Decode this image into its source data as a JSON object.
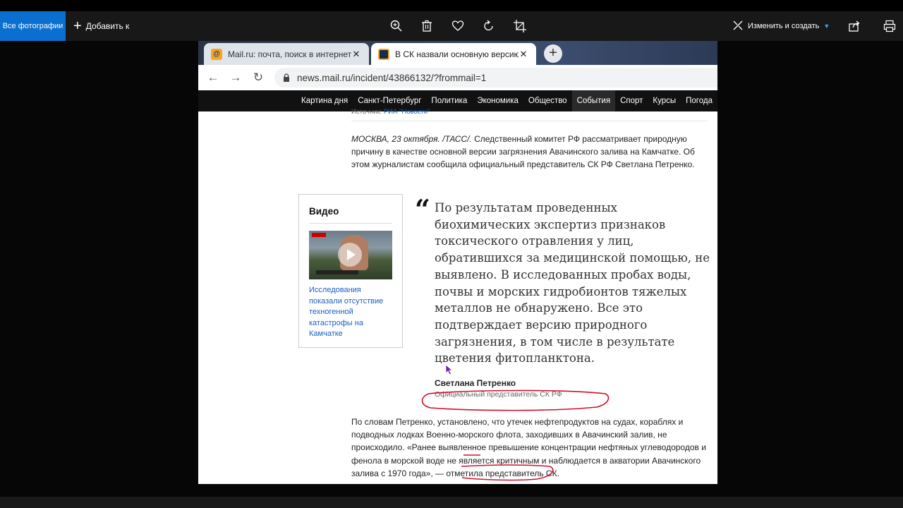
{
  "photos_app": {
    "all_photos": "Все фотографии",
    "add_to": "Добавить к",
    "edit_create": "Изменить и создать",
    "icons": [
      "zoom-icon",
      "delete-icon",
      "favorite-icon",
      "rotate-icon",
      "crop-icon",
      "share-icon",
      "print-icon"
    ],
    "accent_color": "#0a6fce"
  },
  "browser": {
    "tabs": [
      {
        "title": "Mail.ru: почта, поиск в интернете",
        "favicon": "mail-at-icon",
        "active": false
      },
      {
        "title": "В СК назвали основную версию",
        "favicon": "news-icon",
        "active": true
      }
    ],
    "url": "news.mail.ru/incident/43866132/?frommail=1"
  },
  "site_nav": [
    "Картина дня",
    "Санкт-Петербург",
    "Политика",
    "Экономика",
    "Общество",
    "События",
    "Спорт",
    "Курсы",
    "Погода"
  ],
  "site_nav_selected": "События",
  "article": {
    "source_label": "Источник:",
    "source_name": "РИА \"Новости\"",
    "lead_italic": "МОСКВА, 23 октября. /ТАСС/.",
    "lead_text": " Следственный комитет РФ рассматривает природную причину в качестве основной версии загрязнения Авачинского залива на Камчатке. Об этом журналистам сообщила официальный представитель СК РФ Светлана Петренко.",
    "video_heading": "Видео",
    "video_caption": "Исследования показали отсутствие техногенной катастрофы на Камчатке",
    "quote": "По результатам проведенных биохимических экспертиз признаков токсического отравления у лиц, обратившихся за медицинской помощью, не выявлено. В исследованных пробах воды, почвы и морских гидробионтов тяжелых металлов не обнаружено. Все это подтверждает версию природного загрязнения, в том числе в результате цветения фитопланктона.",
    "quote_author": "Светлана Петренко",
    "quote_author_role": "Официальный представитель СК РФ",
    "paragraph": "По словам Петренко, установлено, что утечек нефтепродуктов на судах, кораблях и подводных лодках Военно-морского флота, заходивших в Авачинский залив, не происходило. «Ранее выявленное превышение концентрации нефтяных углеводородов и фенола в морской воде не является критичным и наблюдается в акватории Авачинского залива с 1970 года», — отметила представитель СК."
  },
  "annotation_color": "#d0102a"
}
